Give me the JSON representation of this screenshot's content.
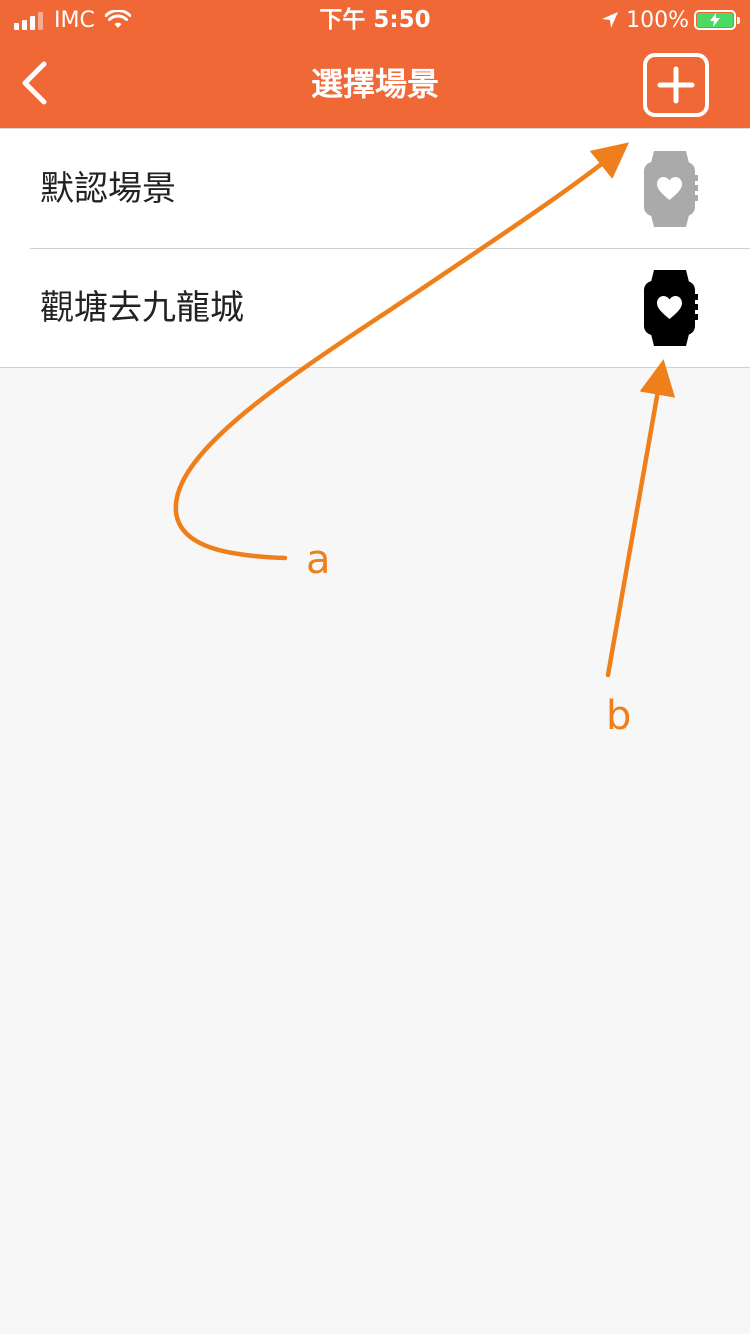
{
  "status_bar": {
    "carrier": "IMC",
    "time": "下午 5:50",
    "battery": "100%"
  },
  "nav": {
    "title": "選擇場景",
    "back_icon": "chevron-left-icon",
    "add_icon": "plus-square-icon"
  },
  "scenes": [
    {
      "label": "默認場景",
      "icon": "watch-heart-icon",
      "selected": false,
      "icon_color": "#aaaaaa"
    },
    {
      "label": "觀塘去九龍城",
      "icon": "watch-heart-icon",
      "selected": true,
      "icon_color": "#000000"
    }
  ],
  "annotations": {
    "a": "a",
    "b": "b",
    "color": "#ef7f1a"
  },
  "colors": {
    "accent": "#ef6835",
    "background": "#f7f7f7"
  }
}
